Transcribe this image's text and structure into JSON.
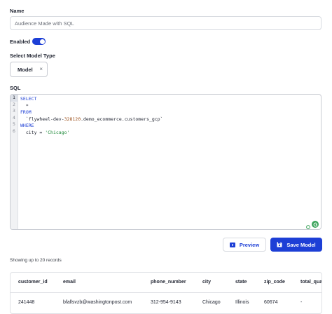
{
  "form": {
    "name_label": "Name",
    "name_value": "Audience Made with SQL",
    "enabled_label": "Enabled",
    "enabled": true,
    "model_type_label": "Select Model Type",
    "model_chip": "Model",
    "chip_remove": "×",
    "sql_label": "SQL"
  },
  "editor": {
    "line_numbers": [
      "1",
      "2",
      "3",
      "4",
      "5",
      "6"
    ],
    "lines": {
      "l1_kw": "SELECT",
      "l2_text": "  *",
      "l3_kw": "FROM",
      "l4_prefix": "  `flywheel-dev-",
      "l4_num": "328120",
      "l4_suffix": ".demo_ecommerce.customers_gcp`",
      "l5_kw": "WHERE",
      "l6_prefix": "  city = ",
      "l6_str": "'Chicago'"
    },
    "icons": [
      "lightbulb-icon",
      "grammarly-icon"
    ]
  },
  "actions": {
    "preview_label": "Preview",
    "save_label": "Save Model"
  },
  "results": {
    "note": "Showing up to 20 records",
    "columns": [
      "customer_id",
      "email",
      "phone_number",
      "city",
      "state",
      "zip_code",
      "total_qua"
    ],
    "rows": [
      [
        "241448",
        "bfallsvzb@washingtonpost.com",
        "312-954-9143",
        "Chicago",
        "Illinois",
        "60674",
        "-"
      ]
    ]
  },
  "colors": {
    "accent": "#1d3fd6",
    "keyword": "#1d3fd6",
    "number": "#9a4c16",
    "string": "#1f8a3a"
  }
}
